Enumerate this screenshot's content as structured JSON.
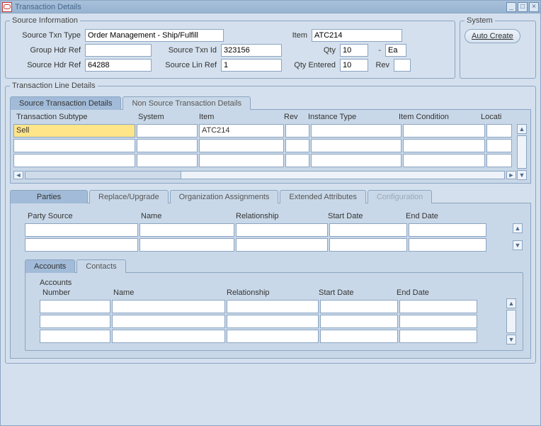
{
  "window": {
    "title": "Transaction Details"
  },
  "source_info": {
    "legend": "Source Information",
    "labels": {
      "txn_type": "Source Txn Type",
      "item": "Item",
      "group_hdr": "Group Hdr Ref",
      "txn_id": "Source Txn Id",
      "qty": "Qty",
      "dash": "-",
      "src_hdr": "Source Hdr Ref",
      "lin_ref": "Source Lin Ref",
      "qty_entered": "Qty Entered",
      "rev": "Rev"
    },
    "values": {
      "txn_type": "Order Management - Ship/Fulfill",
      "item": "ATC214",
      "group_hdr": "",
      "txn_id": "323156",
      "qty": "10",
      "uom": "Ea",
      "src_hdr": "64288",
      "lin_ref": "1",
      "qty_entered": "10",
      "rev": ""
    }
  },
  "system_box": {
    "legend": "System",
    "auto_create": "Auto Create"
  },
  "txn_line_details": {
    "legend": "Transaction Line Details",
    "tabs": {
      "source": "Source Transaction Details",
      "non_source": "Non Source Transaction Details"
    },
    "columns": {
      "subtype": "Transaction Subtype",
      "system": "System",
      "item": "Item",
      "rev": "Rev",
      "instance_type": "Instance Type",
      "item_condition": "Item Condition",
      "location": "Locati"
    },
    "rows": [
      {
        "subtype": "Sell",
        "system": "",
        "item": "ATC214",
        "rev": "",
        "instance_type": "",
        "item_condition": "",
        "location": ""
      },
      {
        "subtype": "",
        "system": "",
        "item": "",
        "rev": "",
        "instance_type": "",
        "item_condition": "",
        "location": ""
      },
      {
        "subtype": "",
        "system": "",
        "item": "",
        "rev": "",
        "instance_type": "",
        "item_condition": "",
        "location": ""
      }
    ]
  },
  "lower_tabs": {
    "parties": "Parties",
    "replace": "Replace/Upgrade",
    "org": "Organization Assignments",
    "ext": "Extended Attributes",
    "config": "Configuration"
  },
  "parties_grid": {
    "columns": {
      "party_source": "Party Source",
      "name": "Name",
      "relationship": "Relationship",
      "start_date": "Start Date",
      "end_date": "End Date"
    }
  },
  "accounts_tabs": {
    "accounts": "Accounts",
    "contacts": "Contacts"
  },
  "accounts_grid": {
    "header": "Accounts",
    "columns": {
      "number": "Number",
      "name": "Name",
      "relationship": "Relationship",
      "start_date": "Start Date",
      "end_date": "End Date"
    }
  }
}
